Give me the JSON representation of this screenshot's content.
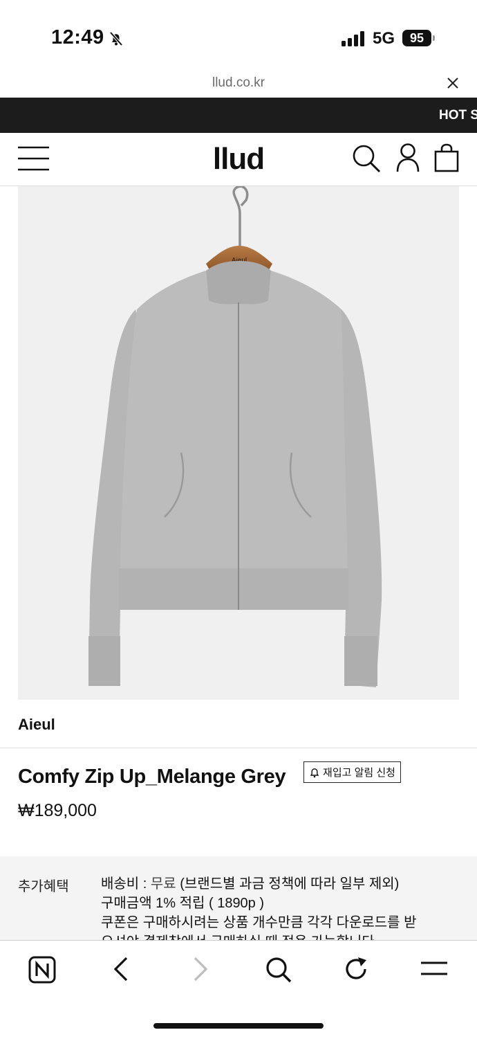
{
  "status_bar": {
    "time": "12:49",
    "network": "5G",
    "battery": "95"
  },
  "browser": {
    "url": "llud.co.kr"
  },
  "promo": {
    "text": "HOT S"
  },
  "header": {
    "logo": "llud"
  },
  "product": {
    "hanger_label": "Aieul",
    "brand": "Aieul",
    "name": "Comfy Zip Up_Melange Grey",
    "restock_label": "재입고 알림 신청",
    "price": "₩189,000"
  },
  "benefits": {
    "label": "추가혜택",
    "shipping_prefix": "배송비 : ",
    "shipping_free": "무료",
    "shipping_suffix": " (브랜드별 과금 정책에 따라 일부 제외)",
    "points": "구매금액 1% 적립 ( 1890p )",
    "coupon_line1": "쿠폰은 구매하시려는 상품 개수만큼 각각 다운로드를 받",
    "coupon_line2": "으셔야 결제창에서 구매하실 때 적용 가능합니다."
  },
  "icons": {
    "menu": "menu-icon",
    "search": "search-icon",
    "account": "user-icon",
    "cart": "bag-icon",
    "home": "naver-home-icon",
    "back": "chevron-left-icon",
    "forward": "chevron-right-icon",
    "reload": "reload-icon",
    "more": "menu-lines-icon",
    "alert": "bell-icon",
    "mute": "bell-slash-icon"
  }
}
